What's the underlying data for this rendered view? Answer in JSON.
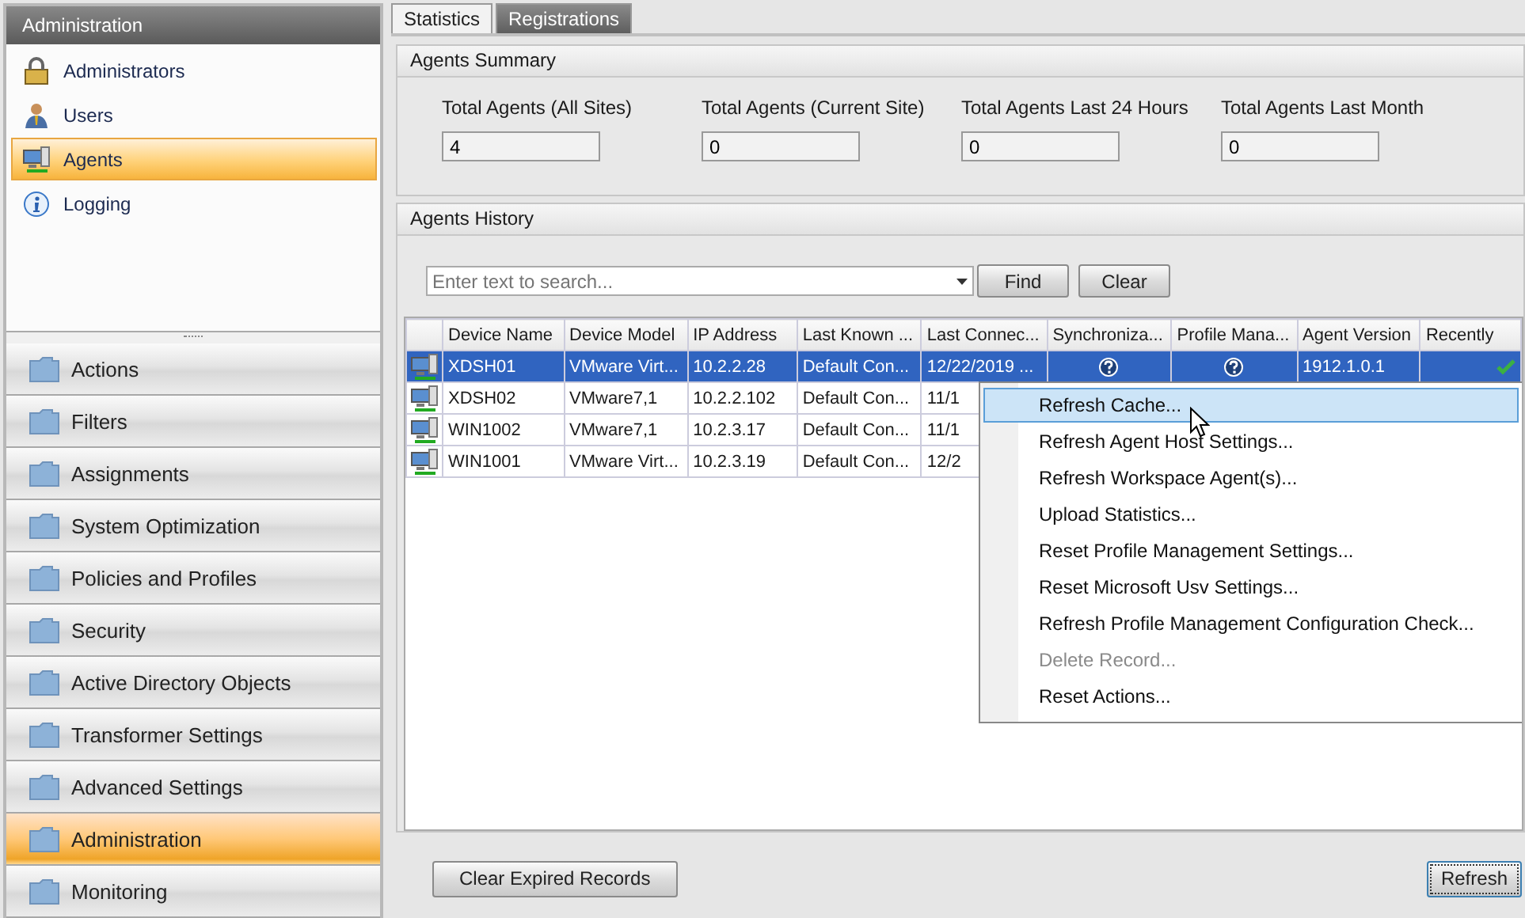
{
  "sidebar": {
    "title": "Administration",
    "items": [
      {
        "label": "Administrators",
        "kind": "lock",
        "selected": false
      },
      {
        "label": "Users",
        "kind": "user",
        "selected": false
      },
      {
        "label": "Agents",
        "kind": "computer",
        "selected": true
      },
      {
        "label": "Logging",
        "kind": "info",
        "selected": false
      }
    ],
    "sections": [
      {
        "label": "Actions",
        "selected": false
      },
      {
        "label": "Filters",
        "selected": false
      },
      {
        "label": "Assignments",
        "selected": false
      },
      {
        "label": "System Optimization",
        "selected": false
      },
      {
        "label": "Policies and Profiles",
        "selected": false
      },
      {
        "label": "Security",
        "selected": false
      },
      {
        "label": "Active Directory Objects",
        "selected": false
      },
      {
        "label": "Transformer Settings",
        "selected": false
      },
      {
        "label": "Advanced Settings",
        "selected": false
      },
      {
        "label": "Administration",
        "selected": true
      },
      {
        "label": "Monitoring",
        "selected": false
      }
    ]
  },
  "tabs": [
    {
      "label": "Statistics",
      "selected": true
    },
    {
      "label": "Registrations",
      "selected": false
    }
  ],
  "summary": {
    "title": "Agents Summary",
    "stats": [
      {
        "label": "Total Agents (All Sites)",
        "value": "4"
      },
      {
        "label": "Total Agents (Current Site)",
        "value": "0"
      },
      {
        "label": "Total Agents Last 24 Hours",
        "value": "0"
      },
      {
        "label": "Total Agents Last Month",
        "value": "0"
      }
    ]
  },
  "history": {
    "title": "Agents History",
    "search": {
      "placeholder": "Enter text to search..."
    },
    "buttons": [
      "Find",
      "Clear"
    ],
    "table": {
      "columns": [
        "Device Name",
        "Device Model",
        "IP Address",
        "Last Known ...",
        "Last Connec...",
        "Synchroniza...",
        "Profile Mana...",
        "Agent Version",
        "Recently"
      ],
      "rows": [
        {
          "selected": true,
          "cells": [
            {
              "kind": "text",
              "text": "XDSH01"
            },
            {
              "kind": "text",
              "text": "VMware Virt..."
            },
            {
              "kind": "text",
              "text": "10.2.2.28"
            },
            {
              "kind": "text",
              "text": "Default Con..."
            },
            {
              "kind": "text",
              "text": "12/22/2019 ..."
            },
            {
              "kind": "help"
            },
            {
              "kind": "help"
            },
            {
              "kind": "text",
              "text": "1912.1.0.1"
            },
            {
              "kind": "check"
            }
          ]
        },
        {
          "selected": false,
          "cells": [
            {
              "kind": "text",
              "text": "XDSH02"
            },
            {
              "kind": "text",
              "text": "VMware7,1"
            },
            {
              "kind": "text",
              "text": "10.2.2.102"
            },
            {
              "kind": "text",
              "text": "Default Con..."
            },
            {
              "kind": "text",
              "text": "11/1"
            }
          ]
        },
        {
          "selected": false,
          "cells": [
            {
              "kind": "text",
              "text": "WIN1002"
            },
            {
              "kind": "text",
              "text": "VMware7,1"
            },
            {
              "kind": "text",
              "text": "10.2.3.17"
            },
            {
              "kind": "text",
              "text": "Default Con..."
            },
            {
              "kind": "text",
              "text": "11/1"
            }
          ]
        },
        {
          "selected": false,
          "cells": [
            {
              "kind": "text",
              "text": "WIN1001"
            },
            {
              "kind": "text",
              "text": "VMware Virt..."
            },
            {
              "kind": "text",
              "text": "10.2.3.19"
            },
            {
              "kind": "text",
              "text": "Default Con..."
            },
            {
              "kind": "text",
              "text": "12/2"
            }
          ]
        }
      ]
    }
  },
  "context_menu": {
    "items": [
      {
        "label": "Refresh Cache...",
        "highlighted": true,
        "disabled": false
      },
      {
        "label": "Refresh Agent Host Settings...",
        "highlighted": false,
        "disabled": false
      },
      {
        "label": "Refresh Workspace Agent(s)...",
        "highlighted": false,
        "disabled": false
      },
      {
        "label": "Upload Statistics...",
        "highlighted": false,
        "disabled": false
      },
      {
        "label": "Reset Profile Management Settings...",
        "highlighted": false,
        "disabled": false
      },
      {
        "label": "Reset Microsoft Usv Settings...",
        "highlighted": false,
        "disabled": false
      },
      {
        "label": "Refresh Profile Management Configuration Check...",
        "highlighted": false,
        "disabled": false
      },
      {
        "label": "Delete Record...",
        "highlighted": false,
        "disabled": true
      },
      {
        "label": "Reset Actions...",
        "highlighted": false,
        "disabled": false
      }
    ]
  },
  "footer_buttons": [
    "Clear Expired Records",
    "Refresh"
  ]
}
